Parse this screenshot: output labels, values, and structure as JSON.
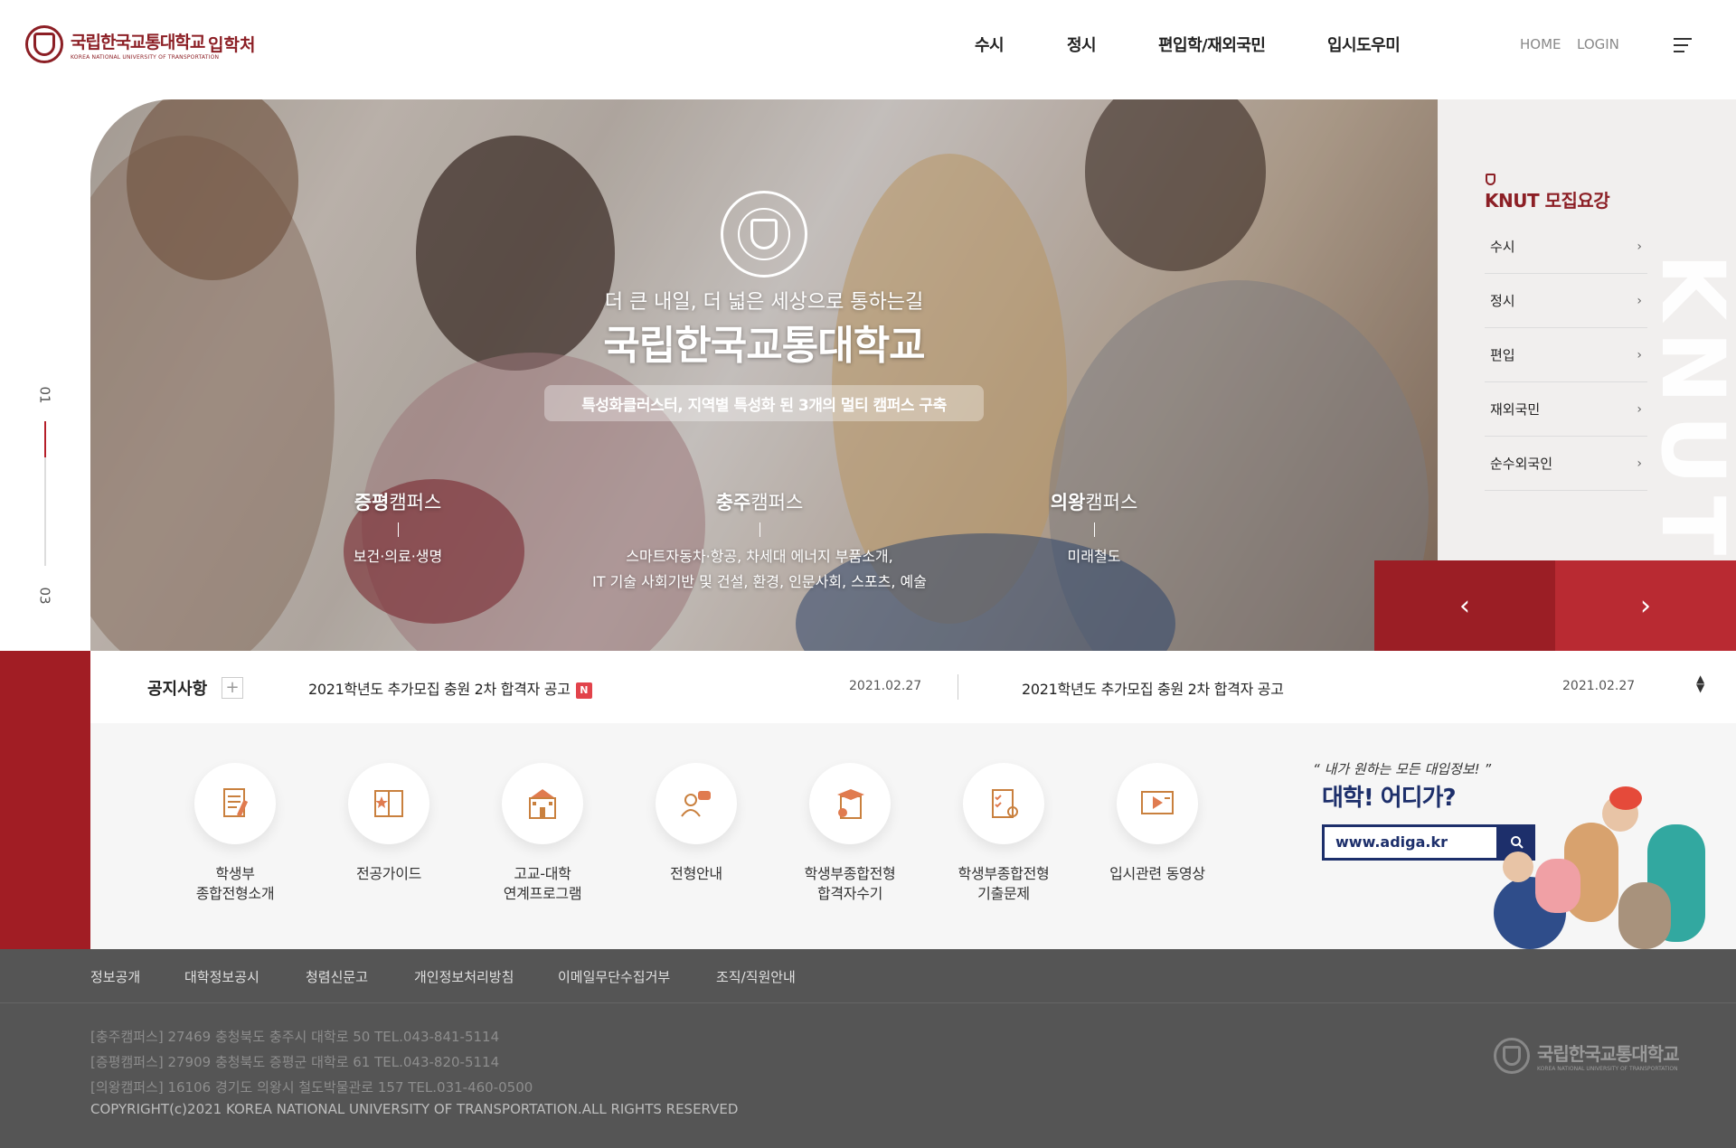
{
  "header": {
    "logo_name": "국립한국교통대학교",
    "logo_eng": "KOREA NATIONAL UNIVERSITY OF TRANSPORTATION",
    "logo_dept": "입학처",
    "nav": [
      "수시",
      "정시",
      "편입학/재외국민",
      "입시도우미"
    ],
    "util": [
      "HOME",
      "LOGIN"
    ]
  },
  "pager": {
    "current": "01",
    "total": "03"
  },
  "hero": {
    "subtitle": "더 큰 내일, 더 넓은 세상으로 통하는길",
    "title": "국립한국교통대학교",
    "pill": "특성화클러스터, 지역별 특성화 된 3개의 멀티 캠퍼스 구축",
    "campuses": [
      {
        "name_bold": "증평",
        "name_rest": "캠퍼스",
        "desc1": "보건·의료·생명",
        "desc2": ""
      },
      {
        "name_bold": "충주",
        "name_rest": "캠퍼스",
        "desc1": "스마트자동차·항공, 차세대 에너지 부품소개,",
        "desc2": "IT 기술 사회기반 및 건설, 환경, 인문사회, 스포츠, 예술"
      },
      {
        "name_bold": "의왕",
        "name_rest": "캠퍼스",
        "desc1": "미래철도",
        "desc2": ""
      }
    ]
  },
  "recruit": {
    "title": "KNUT 모집요강",
    "items": [
      "수시",
      "정시",
      "편입",
      "재외국민",
      "순수외국인"
    ],
    "arrow": "›",
    "deco": "KNUT",
    "prev": "‹",
    "next": "›"
  },
  "notice": {
    "label": "공지사항",
    "plus": "+",
    "items": [
      {
        "title": "2021학년도 추가모집 충원 2차 합격자 공고",
        "badge": "N",
        "date": "2021.02.27"
      },
      {
        "title": "2021학년도 추가모집 충원 2차 합격자 공고",
        "badge": "",
        "date": "2021.02.27"
      }
    ]
  },
  "quick": [
    {
      "icon": "document-pen-icon",
      "line1": "학생부",
      "line2": "종합전형소개"
    },
    {
      "icon": "book-star-icon",
      "line1": "전공가이드",
      "line2": ""
    },
    {
      "icon": "school-building-icon",
      "line1": "고교-대학",
      "line2": "연계프로그램"
    },
    {
      "icon": "consultation-icon",
      "line1": "전형안내",
      "line2": ""
    },
    {
      "icon": "graduate-certificate-icon",
      "line1": "학생부종합전형",
      "line2": "합격자수기"
    },
    {
      "icon": "checklist-icon",
      "line1": "학생부종합전형",
      "line2": "기출문제"
    },
    {
      "icon": "video-lecture-icon",
      "line1": "입시관련 동영상",
      "line2": ""
    }
  ],
  "adiga": {
    "quote": "“ 내가 원하는 모든 대입정보! ”",
    "title": "대학! 어디가?",
    "url": "www.adiga.kr"
  },
  "footer": {
    "links": [
      "정보공개",
      "대학정보공시",
      "청렴신문고",
      "개인정보처리방침",
      "이메일무단수집거부",
      "조직/직원안내"
    ],
    "addresses": [
      "[충주캠퍼스] 27469 충청북도 충주시 대학로 50 TEL.043-841-5114",
      "[증평캠퍼스] 27909 충청북도 증평군 대학로 61 TEL.043-820-5114",
      "[의왕캠퍼스] 16106 경기도 의왕시 철도박물관로 157 TEL.031-460-0500"
    ],
    "copyright": "COPYRIGHT(c)2021 KOREA NATIONAL UNIVERSITY OF TRANSPORTATION.ALL RIGHTS RESERVED",
    "logo_name": "국립한국교통대학교",
    "logo_eng": "KOREA NATIONAL UNIVERSITY OF TRANSPORTATION"
  },
  "colors": {
    "brand": "#8c1f25",
    "accent": "#a11d24",
    "adiga": "#1d2f6b",
    "footer": "#555555"
  }
}
